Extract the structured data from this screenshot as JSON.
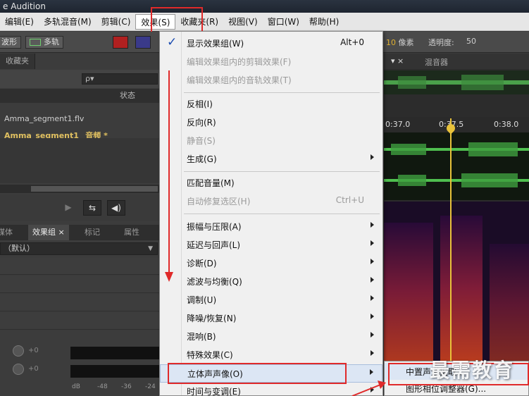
{
  "window": {
    "title": "e Audition"
  },
  "menubar": {
    "items": [
      {
        "label": "编辑(E)"
      },
      {
        "label": "多轨混音(M)"
      },
      {
        "label": "剪辑(C)"
      },
      {
        "label": "效果(S)"
      },
      {
        "label": "收藏夹(R)"
      },
      {
        "label": "视图(V)"
      },
      {
        "label": "窗口(W)"
      },
      {
        "label": "帮助(H)"
      }
    ]
  },
  "toolbar": {
    "waveform_label": "波形",
    "multitrack_label": "多轨",
    "pixels_value": "10",
    "pixels_label": "像素",
    "opacity_label": "透明度:",
    "opacity_value": "50"
  },
  "left_panel": {
    "tab_favorites": "收藏夹",
    "search_placeholder": "ρ▾",
    "col_status": "状态",
    "files": [
      {
        "name": "Amma_segment1.flv"
      },
      {
        "name": "Amma_segment1_ 音频 *"
      }
    ],
    "tabs": [
      {
        "label": "媒体"
      },
      {
        "label": "效果组 ×"
      },
      {
        "label": "标记"
      },
      {
        "label": "属性"
      }
    ],
    "preset": "（默认）",
    "knob_value": "+0",
    "scale": [
      "dB",
      "-48",
      "-36",
      "-24"
    ]
  },
  "editor": {
    "tab_mixer": "混音器",
    "ruler": [
      "0:37.0",
      "0:37.5",
      "0:38.0"
    ]
  },
  "effects_menu": {
    "items": [
      {
        "label": "显示效果组(W)",
        "shortcut": "Alt+0",
        "checked": true,
        "disabled": false,
        "submenu": false
      },
      {
        "label": "编辑效果组内的剪辑效果(F)",
        "shortcut": "",
        "disabled": true,
        "submenu": false
      },
      {
        "label": "编辑效果组内的音轨效果(T)",
        "shortcut": "",
        "disabled": true,
        "submenu": false
      },
      {
        "label": "反相(I)",
        "shortcut": "",
        "disabled": false,
        "submenu": false
      },
      {
        "label": "反向(R)",
        "shortcut": "",
        "disabled": false,
        "submenu": false
      },
      {
        "label": "静音(S)",
        "shortcut": "",
        "disabled": true,
        "submenu": false
      },
      {
        "label": "生成(G)",
        "shortcut": "",
        "disabled": false,
        "submenu": true
      },
      {
        "label": "匹配音量(M)",
        "shortcut": "",
        "disabled": false,
        "submenu": false
      },
      {
        "label": "自动修复选区(H)",
        "shortcut": "Ctrl+U",
        "disabled": true,
        "submenu": false
      },
      {
        "label": "振幅与压限(A)",
        "shortcut": "",
        "disabled": false,
        "submenu": true
      },
      {
        "label": "延迟与回声(L)",
        "shortcut": "",
        "disabled": false,
        "submenu": true
      },
      {
        "label": "诊断(D)",
        "shortcut": "",
        "disabled": false,
        "submenu": true
      },
      {
        "label": "滤波与均衡(Q)",
        "shortcut": "",
        "disabled": false,
        "submenu": true
      },
      {
        "label": "调制(U)",
        "shortcut": "",
        "disabled": false,
        "submenu": true
      },
      {
        "label": "降噪/恢复(N)",
        "shortcut": "",
        "disabled": false,
        "submenu": true
      },
      {
        "label": "混响(B)",
        "shortcut": "",
        "disabled": false,
        "submenu": true
      },
      {
        "label": "特殊效果(C)",
        "shortcut": "",
        "disabled": false,
        "submenu": true
      },
      {
        "label": "立体声声像(O)",
        "shortcut": "",
        "disabled": false,
        "submenu": true,
        "highlighted": true
      },
      {
        "label": "时间与变调(E)",
        "shortcut": "",
        "disabled": false,
        "submenu": true
      }
    ]
  },
  "stereo_submenu": {
    "items": [
      {
        "label": "中置声道提取..."
      },
      {
        "label": "图形相位调整器(G)..."
      }
    ]
  },
  "watermark": "最需教育",
  "colors": {
    "annotation_red": "#e02a2a",
    "accent_yellow": "#e8c23a"
  }
}
